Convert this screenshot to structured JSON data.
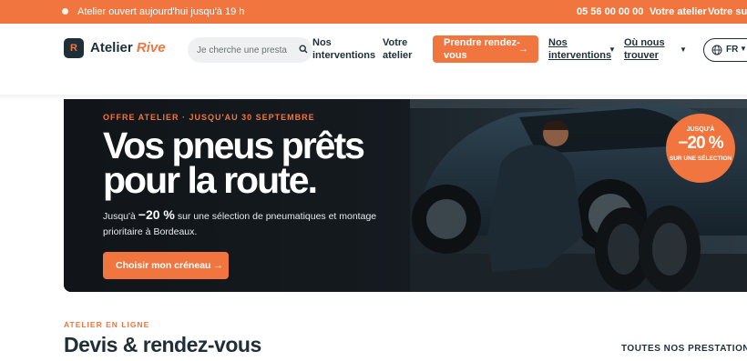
{
  "topbar": {
    "status": "Atelier ouvert aujourd'hui jusqu'à 19 h",
    "phone": "05 56 00 00 00",
    "atelier_link": "Votre atelier",
    "suivi_link": "Votre suivi"
  },
  "header": {
    "logo_letter": "R",
    "logo_name": "Atelier",
    "logo_accent": "Rive",
    "search_placeholder": "Je cherche une presta",
    "nav": {
      "interventions": "Nos interventions",
      "atelier": "Votre atelier",
      "rdv_button": "Prendre rendez-vous",
      "rdv_arrow": "→",
      "interventions_menu": "Nos interventions",
      "trouver_menu": "Où nous trouver"
    },
    "language": "FR"
  },
  "hero": {
    "eyebrow": "OFFRE ATELIER · JUSQU'AU 30 SEPTEMBRE",
    "title": "Vos pneus prêts pour la route.",
    "text_prefix": "Jusqu'à",
    "text_discount": "−20 %",
    "text_suffix": "sur une sélection de pneumatiques et montage prioritaire à Bordeaux.",
    "cta": "Choisir mon créneau →",
    "badge": {
      "top": "JUSQU'À",
      "value": "−20 %",
      "bottom": "SUR UNE SÉLECTION"
    }
  },
  "section": {
    "eyebrow": "ATELIER EN LIGNE",
    "title": "Devis & rendez-vous",
    "all_link": "TOUTES NOS PRESTATIONS →"
  },
  "colors": {
    "accent": "#f0753e",
    "dark": "#1f2f37"
  },
  "icons": [
    "dot-icon",
    "logo-mark",
    "search-icon",
    "chevron-down-icon",
    "globe-icon",
    "arrow-right-icon"
  ]
}
